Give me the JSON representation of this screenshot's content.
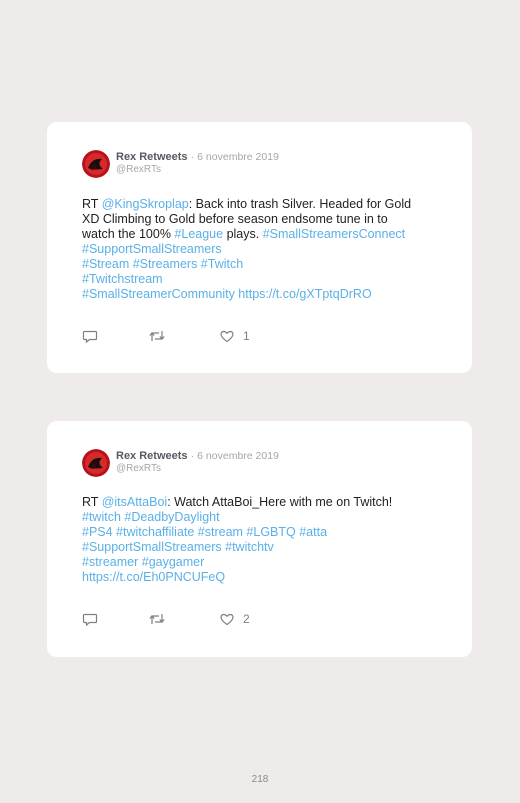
{
  "tweets": [
    {
      "display_name": "Rex Retweets",
      "separator": "·",
      "date": "6 novembre 2019",
      "handle": "@RexRTs",
      "text": {
        "l1_a": "RT ",
        "l1_mention": "@KingSkroplap",
        "l1_b": ": Back into trash Silver. Headed for Gold",
        "l2": "XD Climbing to Gold before season endsome tune in to",
        "l3_a": "watch the 100% ",
        "l3_tag1": "#League",
        "l3_b": " plays. ",
        "l3_tag2": "#SmallStreamersConnect",
        "l4": "#SupportSmallStreamers",
        "l5": "#Stream #Streamers #Twitch",
        "l6": "#Twitchstream",
        "l7": "#SmallStreamerCommunity https://t.co/gXTptqDrRO"
      },
      "likes": "1"
    },
    {
      "display_name": "Rex Retweets",
      "separator": "·",
      "date": "6 novembre 2019",
      "handle": "@RexRTs",
      "text": {
        "l1_a": "RT ",
        "l1_mention": "@itsAttaBoi",
        "l1_b": ": Watch AttaBoi_Here with me on Twitch!",
        "l2": "#twitch #DeadbyDaylight",
        "l3": "#PS4 #twitchaffiliate #stream #LGBTQ #atta",
        "l4": "#SupportSmallStreamers #twitchtv",
        "l5": "#streamer #gaygamer",
        "l6": "https://t.co/Eh0PNCUFeQ"
      },
      "likes": "2"
    }
  ],
  "icons": {
    "avatar": "avatar-image",
    "reply": "reply-icon",
    "retweet": "retweet-icon",
    "like": "heart-icon"
  },
  "colors": {
    "link": "#5ab0e6",
    "background": "#efebeb",
    "card": "#ffffff"
  },
  "page_number": "218"
}
